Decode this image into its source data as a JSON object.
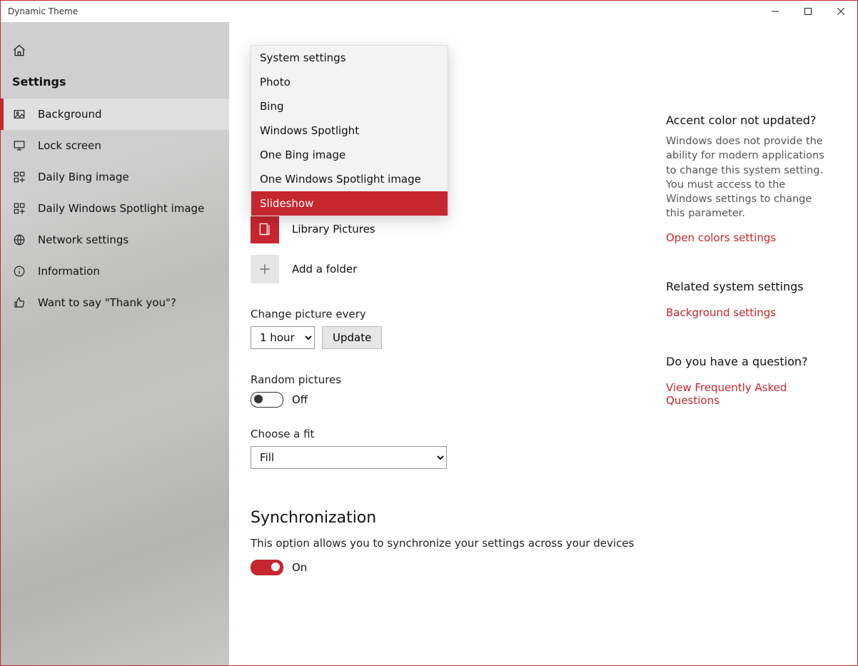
{
  "window": {
    "title": "Dynamic Theme"
  },
  "sidebar": {
    "header": "Settings",
    "items": [
      {
        "label": "Background"
      },
      {
        "label": "Lock screen"
      },
      {
        "label": "Daily Bing image"
      },
      {
        "label": "Daily Windows Spotlight image"
      },
      {
        "label": "Network settings"
      },
      {
        "label": "Information"
      },
      {
        "label": "Want to say \"Thank you\"?"
      }
    ]
  },
  "dropdown": {
    "options": [
      "System settings",
      "Photo",
      "Bing",
      "Windows Spotlight",
      "One Bing image",
      "One Windows Spotlight image",
      "Slideshow"
    ],
    "selected": "Slideshow"
  },
  "folders": {
    "library": "Library Pictures",
    "add": "Add a folder"
  },
  "changeEvery": {
    "label": "Change picture every",
    "value": "1 hour",
    "updateBtn": "Update"
  },
  "random": {
    "label": "Random pictures",
    "state": "Off"
  },
  "fit": {
    "label": "Choose a fit",
    "value": "Fill"
  },
  "sync": {
    "heading": "Synchronization",
    "desc": "This option allows you to synchronize your settings across your devices",
    "state": "On"
  },
  "side": {
    "accent": {
      "heading": "Accent color not updated?",
      "text": "Windows does not provide the ability for modern applications to change this system setting. You must access to the Windows settings to change this parameter.",
      "link": "Open colors settings"
    },
    "related": {
      "heading": "Related system settings",
      "link": "Background settings"
    },
    "question": {
      "heading": "Do you have a question?",
      "link": "View Frequently Asked Questions"
    }
  }
}
